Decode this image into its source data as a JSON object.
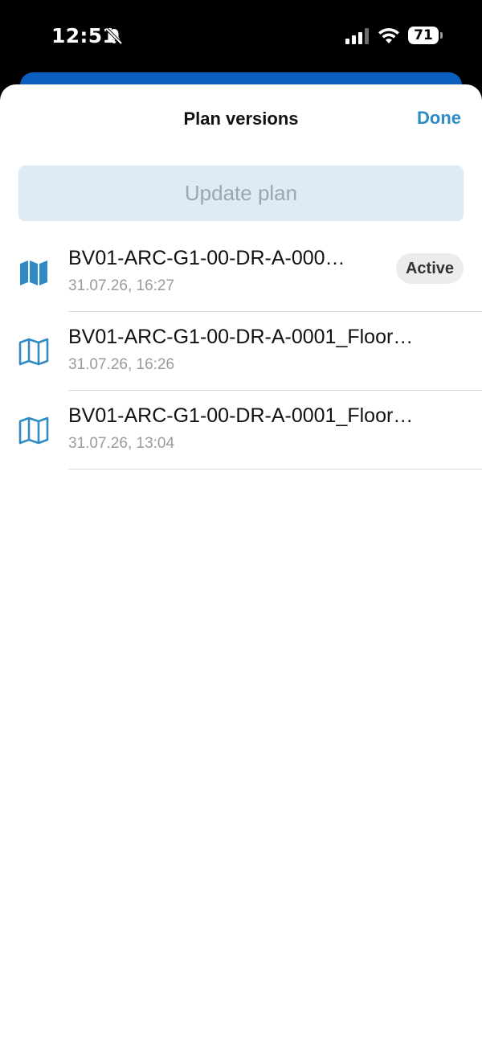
{
  "status_bar": {
    "time": "12:51",
    "battery": "71"
  },
  "sheet": {
    "title": "Plan versions",
    "done_label": "Done",
    "update_label": "Update plan"
  },
  "colors": {
    "accent": "#2f8bc4",
    "update_button_bg": "#deebf5",
    "behind_card": "#0b5fbf"
  },
  "versions": [
    {
      "name": "BV01-ARC-G1-00-DR-A-000…",
      "date": "31.07.26, 16:27",
      "badge": "Active",
      "icon": "map-filled-icon"
    },
    {
      "name": "BV01-ARC-G1-00-DR-A-0001_Floor…",
      "date": "31.07.26, 16:26",
      "icon": "map-outline-icon"
    },
    {
      "name": "BV01-ARC-G1-00-DR-A-0001_Floor…",
      "date": "31.07.26, 13:04",
      "icon": "map-outline-icon"
    }
  ]
}
